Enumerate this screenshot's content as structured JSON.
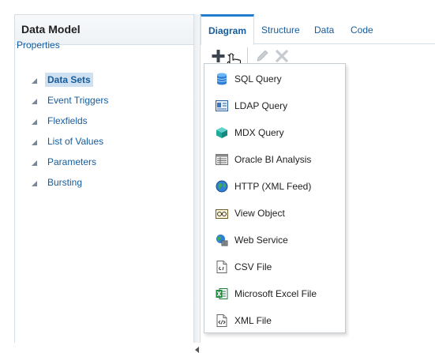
{
  "left_panel": {
    "title": "Data Model",
    "properties_label": "Properties",
    "items": [
      {
        "label": "Data Sets",
        "selected": true
      },
      {
        "label": "Event Triggers"
      },
      {
        "label": "Flexfields"
      },
      {
        "label": "List of Values"
      },
      {
        "label": "Parameters"
      },
      {
        "label": "Bursting"
      }
    ]
  },
  "tabs": [
    {
      "label": "Diagram",
      "active": true
    },
    {
      "label": "Structure"
    },
    {
      "label": "Data"
    },
    {
      "label": "Code"
    }
  ],
  "toolbar": {
    "add_icon": "plus-icon",
    "edit_icon": "pencil-icon",
    "delete_icon": "x-icon"
  },
  "menu": {
    "items": [
      {
        "label": "SQL Query",
        "icon": "database-icon"
      },
      {
        "label": "LDAP Query",
        "icon": "ldap-icon"
      },
      {
        "label": "MDX Query",
        "icon": "cube-icon"
      },
      {
        "label": "Oracle BI Analysis",
        "icon": "analysis-icon"
      },
      {
        "label": "HTTP (XML Feed)",
        "icon": "globe-icon"
      },
      {
        "label": "View Object",
        "icon": "view-object-icon"
      },
      {
        "label": "Web Service",
        "icon": "web-service-icon"
      },
      {
        "label": "CSV File",
        "icon": "csv-file-icon"
      },
      {
        "label": "Microsoft Excel File",
        "icon": "excel-icon"
      },
      {
        "label": "XML File",
        "icon": "xml-file-icon"
      }
    ]
  },
  "colors": {
    "link": "#145c9e",
    "accent": "#1f7ecf",
    "selected_bg": "#cfe0f1"
  }
}
